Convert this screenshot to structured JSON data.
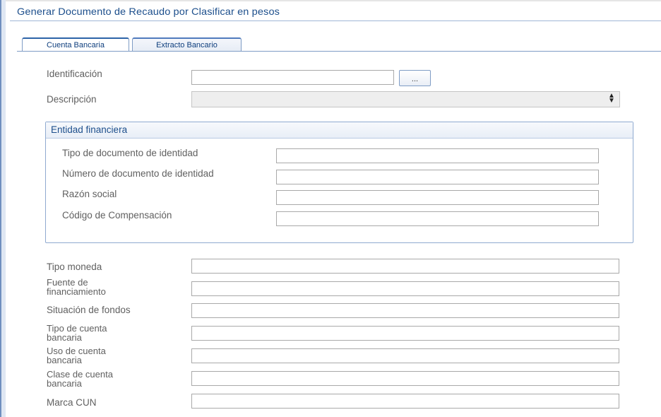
{
  "window": {
    "title": "Generar Documento de Recaudo por Clasificar en pesos"
  },
  "tabs": [
    {
      "label": "Cuenta Bancaria",
      "active": true
    },
    {
      "label": "Extracto Bancario",
      "active": false
    }
  ],
  "form": {
    "identificacion": {
      "label": "Identificación",
      "value": "",
      "lookup_label": "..."
    },
    "descripcion": {
      "label": "Descripción",
      "value": ""
    }
  },
  "entidad": {
    "title": "Entidad financiera",
    "fields": [
      {
        "label": "Tipo de documento de identidad",
        "value": ""
      },
      {
        "label": "Número de documento de identidad",
        "value": ""
      },
      {
        "label": "Razón social",
        "value": ""
      },
      {
        "label": "Código de Compensación",
        "value": ""
      }
    ]
  },
  "details": [
    {
      "label": "Tipo moneda",
      "value": ""
    },
    {
      "label": "Fuente de financiamiento",
      "value": ""
    },
    {
      "label": "Situación de fondos",
      "value": ""
    },
    {
      "label": "Tipo de cuenta bancaria",
      "value": ""
    },
    {
      "label": "Uso de cuenta bancaria",
      "value": ""
    },
    {
      "label": "Clase de cuenta bancaria",
      "value": ""
    },
    {
      "label": "Marca CUN",
      "value": ""
    }
  ],
  "colors": {
    "accent": "#1d4f8c",
    "border": "#8faad0",
    "label": "#606060"
  },
  "icons": {
    "spinner": "up-down-spinner-icon"
  }
}
